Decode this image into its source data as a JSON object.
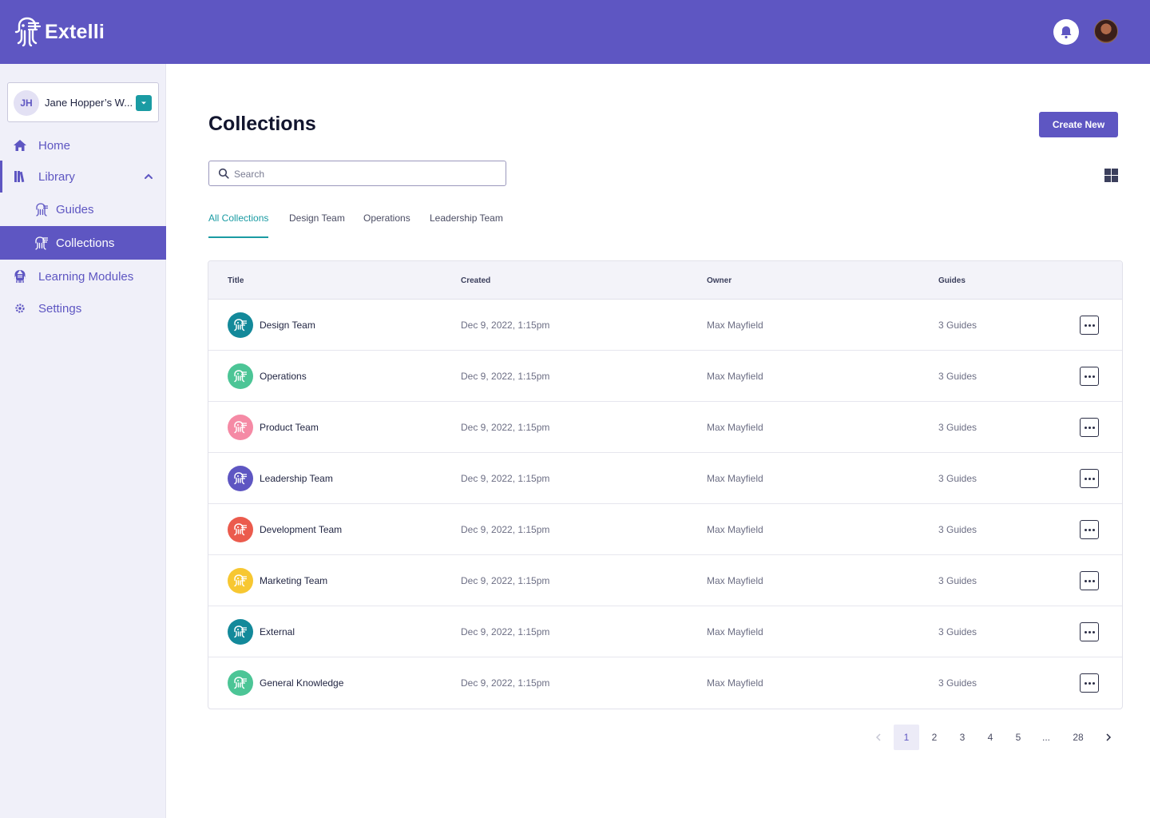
{
  "brand": {
    "name": "Extelli",
    "header_color": "#5e56c2",
    "accent_teal": "#1a9ba3"
  },
  "header": {
    "notifications_icon": "bell-icon",
    "user_avatar": "user-avatar"
  },
  "sidebar": {
    "workspace": {
      "initials": "JH",
      "name": "Jane Hopper’s W..."
    },
    "nav": {
      "home": "Home",
      "library": "Library",
      "guides": "Guides",
      "collections": "Collections",
      "learning_modules": "Learning Modules",
      "settings": "Settings"
    }
  },
  "main": {
    "title": "Collections",
    "create_button": "Create New",
    "search_placeholder": "Search",
    "tabs": [
      "All Collections",
      "Design Team",
      "Operations",
      "Leadership Team"
    ],
    "active_tab": 0
  },
  "table": {
    "headers": {
      "title": "Title",
      "created": "Created",
      "owner": "Owner",
      "guides": "Guides"
    },
    "rows": [
      {
        "title": "Design Team",
        "created": "Dec 9, 2022, 1:15pm",
        "owner": "Max Mayfield",
        "guides": "3 Guides",
        "color": "#13899a"
      },
      {
        "title": "Operations",
        "created": "Dec 9, 2022, 1:15pm",
        "owner": "Max Mayfield",
        "guides": "3 Guides",
        "color": "#4cc596"
      },
      {
        "title": "Product Team",
        "created": "Dec 9, 2022, 1:15pm",
        "owner": "Max Mayfield",
        "guides": "3 Guides",
        "color": "#f58aa5"
      },
      {
        "title": "Leadership Team",
        "created": "Dec 9, 2022, 1:15pm",
        "owner": "Max Mayfield",
        "guides": "3 Guides",
        "color": "#5e56c2"
      },
      {
        "title": "Development Team",
        "created": "Dec 9, 2022, 1:15pm",
        "owner": "Max Mayfield",
        "guides": "3 Guides",
        "color": "#eb5b4d"
      },
      {
        "title": "Marketing Team",
        "created": "Dec 9, 2022, 1:15pm",
        "owner": "Max Mayfield",
        "guides": "3 Guides",
        "color": "#f7c731"
      },
      {
        "title": "External",
        "created": "Dec 9, 2022, 1:15pm",
        "owner": "Max Mayfield",
        "guides": "3 Guides",
        "color": "#13899a"
      },
      {
        "title": "General Knowledge",
        "created": "Dec 9, 2022, 1:15pm",
        "owner": "Max Mayfield",
        "guides": "3 Guides",
        "color": "#4cc596"
      }
    ]
  },
  "pagination": {
    "pages": [
      "1",
      "2",
      "3",
      "4",
      "5",
      "...",
      "28"
    ],
    "current": "1"
  }
}
